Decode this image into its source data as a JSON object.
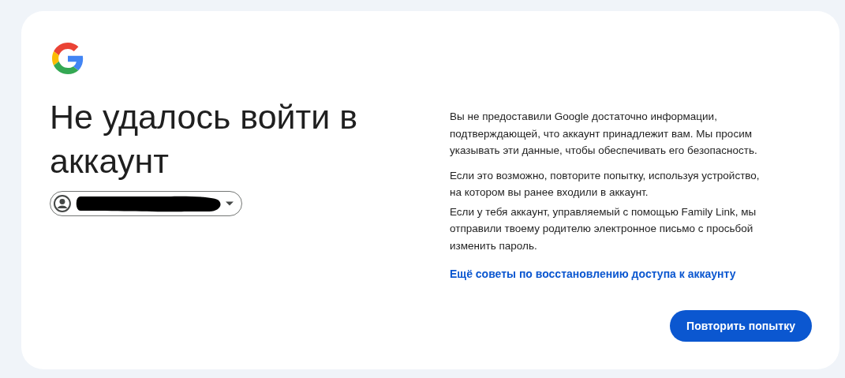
{
  "heading": "Не удалось войти в аккаунт",
  "paragraph_groups": [
    [
      "Вы не предоставили Google достаточно информации, подтверждающей, что аккаунт принадлежит вам. Мы просим указывать эти данные, чтобы обеспечивать его безопасность."
    ],
    [
      "Если это возможно, повторите попытку, используя устройство, на котором вы ранее входили в аккаунт.",
      "Если у тебя аккаунт, управляемый с помощью Family Link, мы отправили твоему родителю электронное письмо с просьбой изменить пароль."
    ]
  ],
  "link": "Ещё советы по восстановлению доступа к аккаунту",
  "button": "Повторить попытку"
}
